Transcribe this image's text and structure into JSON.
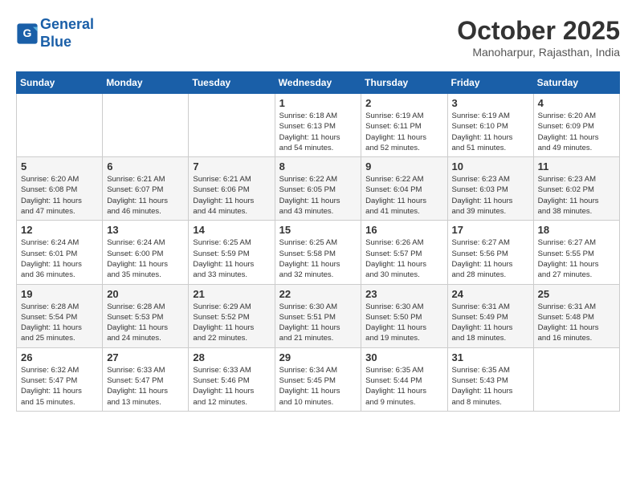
{
  "header": {
    "logo_line1": "General",
    "logo_line2": "Blue",
    "month": "October 2025",
    "location": "Manoharpur, Rajasthan, India"
  },
  "weekdays": [
    "Sunday",
    "Monday",
    "Tuesday",
    "Wednesday",
    "Thursday",
    "Friday",
    "Saturday"
  ],
  "weeks": [
    [
      {
        "day": "",
        "info": ""
      },
      {
        "day": "",
        "info": ""
      },
      {
        "day": "",
        "info": ""
      },
      {
        "day": "1",
        "info": "Sunrise: 6:18 AM\nSunset: 6:13 PM\nDaylight: 11 hours\nand 54 minutes."
      },
      {
        "day": "2",
        "info": "Sunrise: 6:19 AM\nSunset: 6:11 PM\nDaylight: 11 hours\nand 52 minutes."
      },
      {
        "day": "3",
        "info": "Sunrise: 6:19 AM\nSunset: 6:10 PM\nDaylight: 11 hours\nand 51 minutes."
      },
      {
        "day": "4",
        "info": "Sunrise: 6:20 AM\nSunset: 6:09 PM\nDaylight: 11 hours\nand 49 minutes."
      }
    ],
    [
      {
        "day": "5",
        "info": "Sunrise: 6:20 AM\nSunset: 6:08 PM\nDaylight: 11 hours\nand 47 minutes."
      },
      {
        "day": "6",
        "info": "Sunrise: 6:21 AM\nSunset: 6:07 PM\nDaylight: 11 hours\nand 46 minutes."
      },
      {
        "day": "7",
        "info": "Sunrise: 6:21 AM\nSunset: 6:06 PM\nDaylight: 11 hours\nand 44 minutes."
      },
      {
        "day": "8",
        "info": "Sunrise: 6:22 AM\nSunset: 6:05 PM\nDaylight: 11 hours\nand 43 minutes."
      },
      {
        "day": "9",
        "info": "Sunrise: 6:22 AM\nSunset: 6:04 PM\nDaylight: 11 hours\nand 41 minutes."
      },
      {
        "day": "10",
        "info": "Sunrise: 6:23 AM\nSunset: 6:03 PM\nDaylight: 11 hours\nand 39 minutes."
      },
      {
        "day": "11",
        "info": "Sunrise: 6:23 AM\nSunset: 6:02 PM\nDaylight: 11 hours\nand 38 minutes."
      }
    ],
    [
      {
        "day": "12",
        "info": "Sunrise: 6:24 AM\nSunset: 6:01 PM\nDaylight: 11 hours\nand 36 minutes."
      },
      {
        "day": "13",
        "info": "Sunrise: 6:24 AM\nSunset: 6:00 PM\nDaylight: 11 hours\nand 35 minutes."
      },
      {
        "day": "14",
        "info": "Sunrise: 6:25 AM\nSunset: 5:59 PM\nDaylight: 11 hours\nand 33 minutes."
      },
      {
        "day": "15",
        "info": "Sunrise: 6:25 AM\nSunset: 5:58 PM\nDaylight: 11 hours\nand 32 minutes."
      },
      {
        "day": "16",
        "info": "Sunrise: 6:26 AM\nSunset: 5:57 PM\nDaylight: 11 hours\nand 30 minutes."
      },
      {
        "day": "17",
        "info": "Sunrise: 6:27 AM\nSunset: 5:56 PM\nDaylight: 11 hours\nand 28 minutes."
      },
      {
        "day": "18",
        "info": "Sunrise: 6:27 AM\nSunset: 5:55 PM\nDaylight: 11 hours\nand 27 minutes."
      }
    ],
    [
      {
        "day": "19",
        "info": "Sunrise: 6:28 AM\nSunset: 5:54 PM\nDaylight: 11 hours\nand 25 minutes."
      },
      {
        "day": "20",
        "info": "Sunrise: 6:28 AM\nSunset: 5:53 PM\nDaylight: 11 hours\nand 24 minutes."
      },
      {
        "day": "21",
        "info": "Sunrise: 6:29 AM\nSunset: 5:52 PM\nDaylight: 11 hours\nand 22 minutes."
      },
      {
        "day": "22",
        "info": "Sunrise: 6:30 AM\nSunset: 5:51 PM\nDaylight: 11 hours\nand 21 minutes."
      },
      {
        "day": "23",
        "info": "Sunrise: 6:30 AM\nSunset: 5:50 PM\nDaylight: 11 hours\nand 19 minutes."
      },
      {
        "day": "24",
        "info": "Sunrise: 6:31 AM\nSunset: 5:49 PM\nDaylight: 11 hours\nand 18 minutes."
      },
      {
        "day": "25",
        "info": "Sunrise: 6:31 AM\nSunset: 5:48 PM\nDaylight: 11 hours\nand 16 minutes."
      }
    ],
    [
      {
        "day": "26",
        "info": "Sunrise: 6:32 AM\nSunset: 5:47 PM\nDaylight: 11 hours\nand 15 minutes."
      },
      {
        "day": "27",
        "info": "Sunrise: 6:33 AM\nSunset: 5:47 PM\nDaylight: 11 hours\nand 13 minutes."
      },
      {
        "day": "28",
        "info": "Sunrise: 6:33 AM\nSunset: 5:46 PM\nDaylight: 11 hours\nand 12 minutes."
      },
      {
        "day": "29",
        "info": "Sunrise: 6:34 AM\nSunset: 5:45 PM\nDaylight: 11 hours\nand 10 minutes."
      },
      {
        "day": "30",
        "info": "Sunrise: 6:35 AM\nSunset: 5:44 PM\nDaylight: 11 hours\nand 9 minutes."
      },
      {
        "day": "31",
        "info": "Sunrise: 6:35 AM\nSunset: 5:43 PM\nDaylight: 11 hours\nand 8 minutes."
      },
      {
        "day": "",
        "info": ""
      }
    ]
  ]
}
